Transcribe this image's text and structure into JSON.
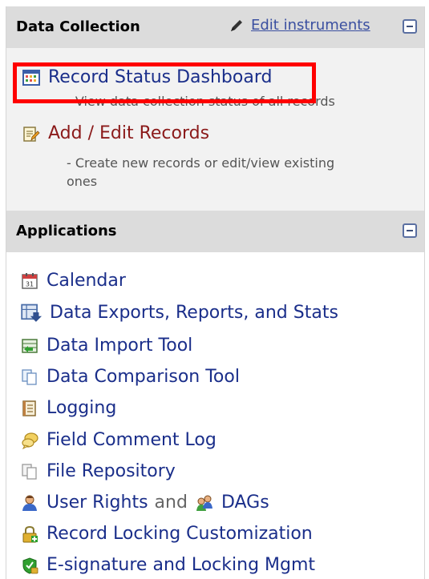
{
  "data_collection": {
    "title": "Data Collection",
    "edit_instruments": "Edit instruments",
    "record_status_dashboard": {
      "label": "Record Status Dashboard",
      "desc": "- View data collection status of all records"
    },
    "add_edit_records": {
      "label": "Add / Edit Records",
      "desc_line1": "- Create new records or edit/view existing",
      "desc_line2": "ones"
    }
  },
  "applications": {
    "title": "Applications",
    "items": [
      {
        "label": "Calendar",
        "icon": "calendar-icon"
      },
      {
        "label": "Data Exports, Reports, and Stats",
        "icon": "data-export-icon"
      },
      {
        "label": "Data Import Tool",
        "icon": "data-import-icon"
      },
      {
        "label": "Data Comparison Tool",
        "icon": "data-comparison-icon"
      },
      {
        "label": "Logging",
        "icon": "logging-icon"
      },
      {
        "label": "Field Comment Log",
        "icon": "comment-log-icon"
      },
      {
        "label": "File Repository",
        "icon": "file-repository-icon"
      },
      {
        "label": "User Rights",
        "icon": "user-icon"
      },
      {
        "label": "Record Locking Customization",
        "icon": "lock-icon"
      },
      {
        "label": "E-signature and Locking Mgmt",
        "icon": "esignature-icon"
      }
    ],
    "and_text": "and",
    "dags_label": "DAGs"
  }
}
